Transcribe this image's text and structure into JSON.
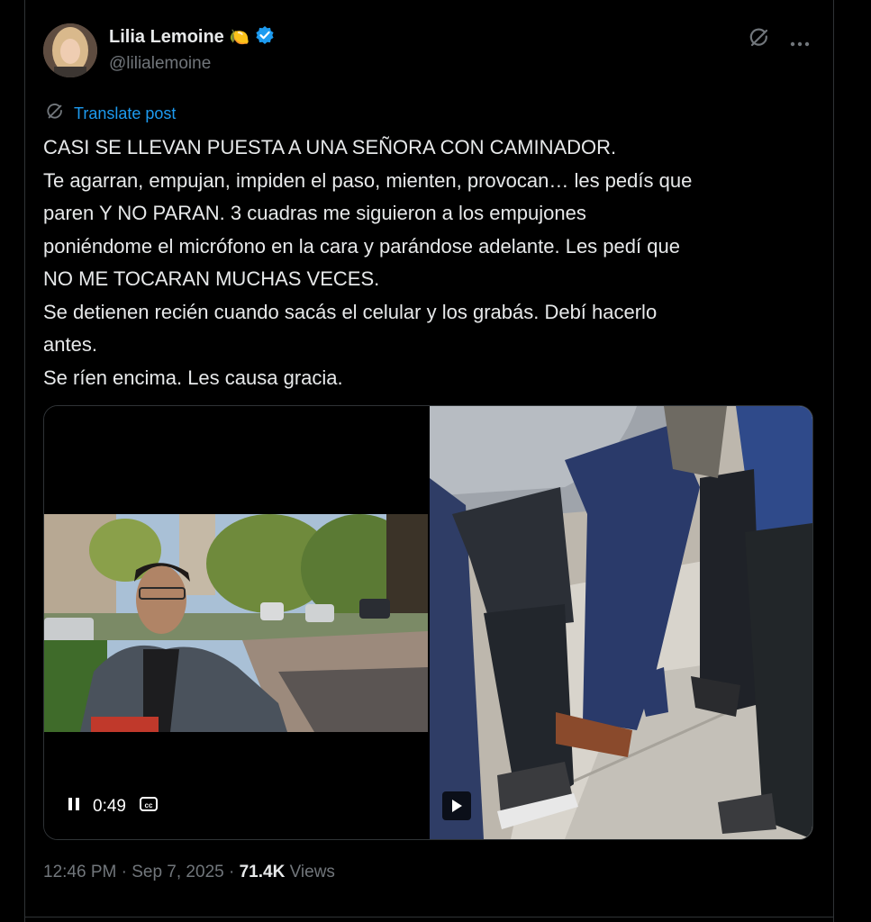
{
  "author": {
    "name": "Lilia Lemoine",
    "handle": "@lilialemoine",
    "emoji": "🍋",
    "verified_color": "#1d9bf0",
    "icons": {
      "verified": "verified-badge-icon",
      "grok": "grok-icon",
      "more": "more-options-icon"
    }
  },
  "translate": {
    "label": "Translate post",
    "icon": "translate-globe-icon"
  },
  "post": {
    "lines": [
      "CASI SE LLEVAN PUESTA A UNA SEÑORA CON CAMINADOR.",
      "Te agarran, empujan, impiden el paso, mienten, provocan… les pedís que",
      "paren Y NO PARAN. 3 cuadras me siguieron a los empujones",
      "poniéndome el micrófono en la cara y parándose adelante. Les pedí que",
      "NO ME TOCARAN MUCHAS VECES.",
      "Se detienen recién cuando sacás el celular y los grabás. Debí hacerlo",
      "antes.",
      "Se ríen encima. Les causa gracia."
    ]
  },
  "media": {
    "video1": {
      "time": "0:49",
      "state": "playing",
      "icons": {
        "pause": "pause-icon",
        "captions": "captions-icon"
      }
    },
    "video2": {
      "state": "paused",
      "icons": {
        "play": "play-icon"
      }
    }
  },
  "meta": {
    "time": "12:46 PM",
    "date": "Sep 7, 2025",
    "views_count": "71.4K",
    "views_label": "Views",
    "separator": "·"
  },
  "colors": {
    "background": "#000000",
    "text": "#e7e9ea",
    "muted": "#71767b",
    "accent": "#1d9bf0",
    "border": "#2f3336"
  }
}
